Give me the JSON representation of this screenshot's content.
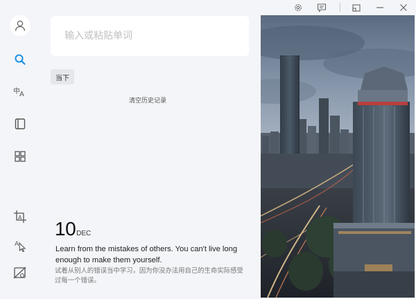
{
  "search": {
    "placeholder": "输入或粘贴单词"
  },
  "history": {
    "tag_label": "当下",
    "clear_label": "清空历史记录"
  },
  "quote": {
    "day": "10",
    "month": "DEC",
    "english": "Learn from the mistakes of others. You can't live long enough to make them yourself.",
    "chinese": "试着从别人的错误当中学习，因为你没办法用自己的生命实际感受过每一个错误。"
  },
  "colors": {
    "accent": "#1a8fe0",
    "background": "#f4f5f8",
    "panel": "#ffffff"
  },
  "sidebar": {
    "items": [
      {
        "icon": "search-icon",
        "active": true
      },
      {
        "icon": "translate-icon"
      },
      {
        "icon": "notebook-icon"
      },
      {
        "icon": "apps-icon"
      },
      {
        "icon": "screenshot-translate-icon"
      },
      {
        "icon": "pick-translate-icon"
      },
      {
        "icon": "disable-pick-icon"
      }
    ]
  },
  "titlebar": {
    "icons": [
      "settings-icon",
      "feedback-icon",
      "mini-window-icon",
      "minimize-icon",
      "close-icon"
    ]
  }
}
